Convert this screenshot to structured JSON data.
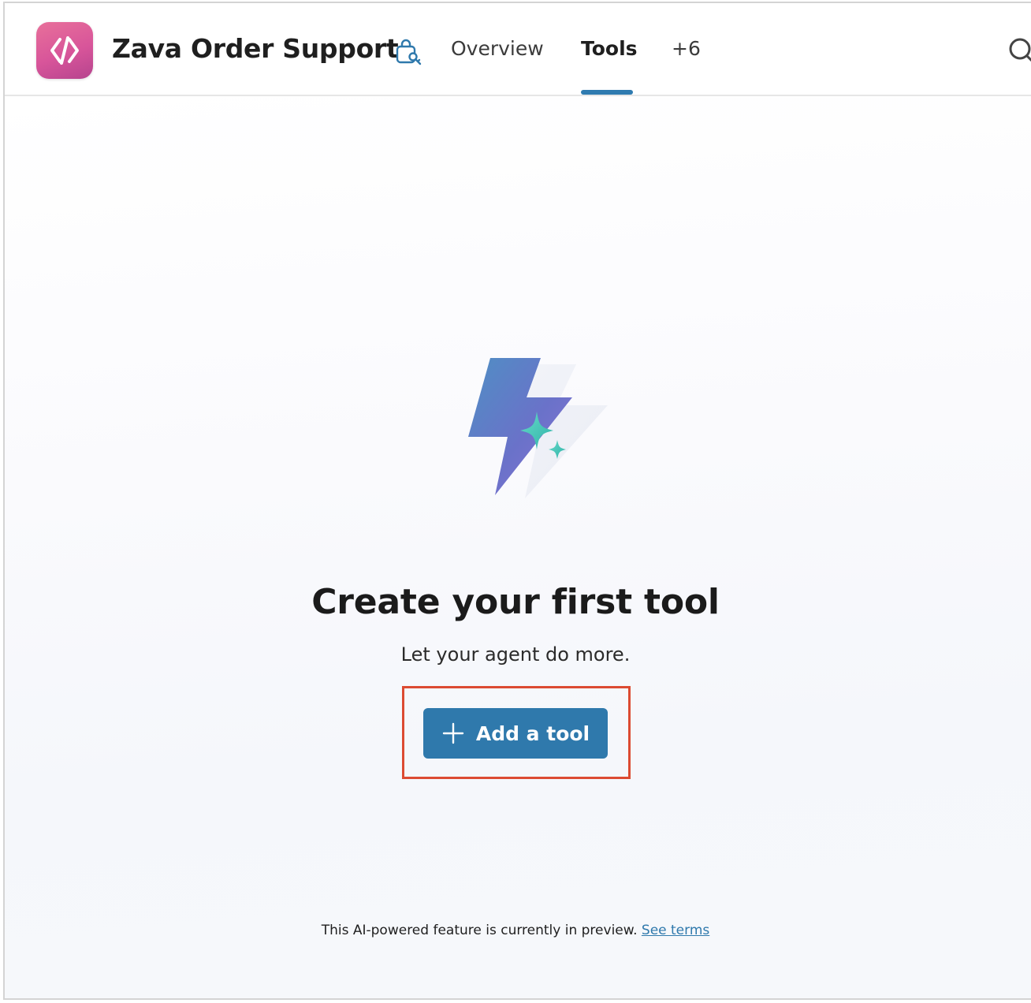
{
  "header": {
    "app_title": "Zava Order Support",
    "tabs": [
      {
        "label": "Overview",
        "active": false
      },
      {
        "label": "Tools",
        "active": true
      },
      {
        "label": "+6",
        "active": false
      }
    ],
    "accent_color": "#2f7bb0"
  },
  "empty_state": {
    "headline": "Create your first tool",
    "subtext": "Let your agent do more.",
    "button_label": "Add a tool",
    "button_color": "#2f79ac",
    "highlight_color": "#dc4b32"
  },
  "footer": {
    "note": "This AI-powered feature is currently in preview.",
    "link_label": "See terms"
  },
  "icons": {
    "app_logo": "code-brackets-icon",
    "publish": "briefcase-key-icon",
    "search": "search-icon",
    "illustration": "lightning-sparkle-icon",
    "button": "plus-icon"
  }
}
